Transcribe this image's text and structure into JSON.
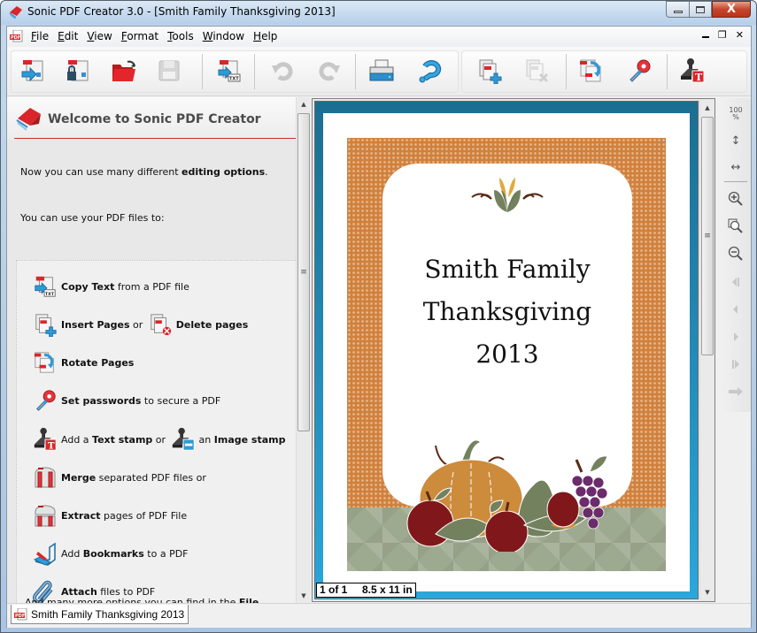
{
  "window": {
    "title": "Sonic PDF Creator 3.0 - [Smith Family Thanksgiving 2013]",
    "minimize": "–",
    "maximize": "□",
    "close": "X"
  },
  "menubar": {
    "items": [
      {
        "label": "File",
        "accel": "F",
        "rest": "ile"
      },
      {
        "label": "Edit",
        "accel": "E",
        "rest": "dit"
      },
      {
        "label": "View",
        "accel": "V",
        "rest": "iew"
      },
      {
        "label": "Format",
        "accel": "F",
        "rest": "ormat"
      },
      {
        "label": "Tools",
        "accel": "T",
        "rest": "ools"
      },
      {
        "label": "Window",
        "accel": "W",
        "rest": "indow"
      },
      {
        "label": "Help",
        "accel": "H",
        "rest": "elp"
      }
    ],
    "mdi": {
      "minimize": "▁",
      "restore": "❐",
      "close": "✕"
    }
  },
  "toolbar": {
    "buttons": [
      {
        "name": "convert-to-pdf",
        "icon": "convert-icon",
        "enabled": true
      },
      {
        "name": "secure-convert",
        "icon": "lock-document-icon",
        "enabled": true
      },
      {
        "name": "open",
        "icon": "open-folder-icon",
        "enabled": true
      },
      {
        "name": "save",
        "icon": "save-icon",
        "enabled": false
      },
      {
        "name": "copy-text",
        "icon": "copy-text-icon",
        "enabled": true
      },
      {
        "name": "undo",
        "icon": "undo-icon",
        "enabled": false
      },
      {
        "name": "redo",
        "icon": "redo-icon",
        "enabled": false
      },
      {
        "name": "print",
        "icon": "printer-icon",
        "enabled": true
      },
      {
        "name": "help",
        "icon": "help-icon",
        "enabled": true
      },
      {
        "name": "insert-pages",
        "icon": "insert-pages-icon",
        "enabled": true
      },
      {
        "name": "delete-pages",
        "icon": "delete-pages-icon",
        "enabled": false
      },
      {
        "name": "rotate-pages",
        "icon": "rotate-pages-icon",
        "enabled": true
      },
      {
        "name": "set-password",
        "icon": "key-icon",
        "enabled": true
      },
      {
        "name": "text-stamp",
        "icon": "stamp-icon",
        "enabled": true
      }
    ]
  },
  "left_panel": {
    "title": "Welcome to Sonic PDF Creator",
    "intro1_pre": "Now you can use many different ",
    "intro1_bold": "editing options",
    "intro1_post": ".",
    "intro2": "You can use your PDF files to:",
    "options": [
      {
        "parts": [
          {
            "b": "Copy Text"
          },
          {
            "t": " from a PDF file"
          }
        ]
      },
      {
        "parts": [
          {
            "b": "Insert Pages"
          },
          {
            "t": " or "
          }
        ],
        "second": [
          {
            "b": "Delete pages"
          }
        ]
      },
      {
        "parts": [
          {
            "b": "Rotate Pages"
          }
        ]
      },
      {
        "parts": [
          {
            "b": "Set passwords"
          },
          {
            "t": " to secure a PDF"
          }
        ]
      },
      {
        "parts": [
          {
            "t": "Add a "
          },
          {
            "b": "Text stamp"
          },
          {
            "t": " or "
          }
        ],
        "second": [
          {
            "t": "an "
          },
          {
            "b": "Image stamp"
          }
        ]
      },
      {
        "parts": [
          {
            "b": "Merge"
          },
          {
            "t": " separated PDF files or"
          }
        ]
      },
      {
        "parts": [
          {
            "b": "Extract"
          },
          {
            "t": " pages of PDF File"
          }
        ]
      },
      {
        "parts": [
          {
            "t": "Add "
          },
          {
            "b": "Bookmarks"
          },
          {
            "t": " to a PDF"
          }
        ]
      },
      {
        "parts": [
          {
            "b": "Attach"
          },
          {
            "t": " files to PDF"
          }
        ]
      }
    ],
    "more_pre": "And many more options you can find in the ",
    "more_bold": "File"
  },
  "document": {
    "line1": "Smith Family",
    "line2": "Thanksgiving",
    "line3": "2013",
    "page_info": "1 of 1     8.5 x 11 in"
  },
  "zoom_bar": {
    "actual_size": "100\n%",
    "fit_height": "↕",
    "fit_width": "↔"
  },
  "tabs": [
    {
      "label": "Smith Family Thanksgiving 2013",
      "active": true
    }
  ],
  "colors": {
    "accent_red": "#d9262b",
    "viewer_blue": "#2aa7dc",
    "orange_border": "#d0813e",
    "green_band": "#9eaa8f"
  }
}
